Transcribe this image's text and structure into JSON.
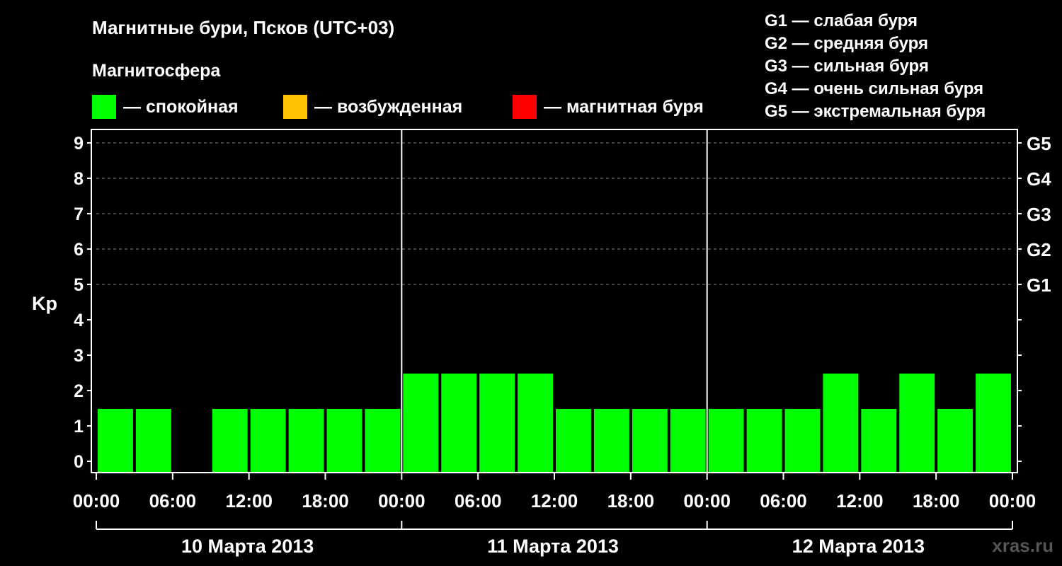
{
  "chart_data": {
    "type": "bar",
    "title": "Магнитные бури, Псков (UTC+03)",
    "subtitle": "Магнитосфера",
    "ylabel": "Kp",
    "ylim": [
      0,
      9
    ],
    "yticks": [
      "0",
      "1",
      "2",
      "3",
      "4",
      "5",
      "6",
      "7",
      "8",
      "9"
    ],
    "g_ticks": [
      {
        "kp": 5,
        "label": "G1"
      },
      {
        "kp": 6,
        "label": "G2"
      },
      {
        "kp": 7,
        "label": "G3"
      },
      {
        "kp": 8,
        "label": "G4"
      },
      {
        "kp": 9,
        "label": "G5"
      }
    ],
    "x_tick_labels": [
      "00:00",
      "06:00",
      "12:00",
      "18:00",
      "00:00",
      "06:00",
      "12:00",
      "18:00",
      "00:00",
      "06:00",
      "12:00",
      "18:00",
      "00:00"
    ],
    "days": [
      "10 Марта 2013",
      "11 Марта 2013",
      "12 Марта 2013"
    ],
    "interval_hours": 3,
    "values": [
      1,
      1,
      0,
      1,
      1,
      1,
      1,
      1,
      2,
      2,
      2,
      2,
      1,
      1,
      1,
      1,
      1,
      1,
      1,
      2,
      1,
      2,
      1,
      2
    ],
    "grid": "dashed-horizontal",
    "legend": [
      {
        "label": "— спокойная",
        "color": "#00ff00"
      },
      {
        "label": "— возбужденная",
        "color": "#ffc000"
      },
      {
        "label": "— магнитная буря",
        "color": "#ff0000"
      }
    ],
    "storm_legend": [
      "G1 — слабая буря",
      "G2 — средняя буря",
      "G3 — сильная буря",
      "G4 — очень сильная буря",
      "G5 — экстремальная буря"
    ]
  },
  "watermark": "xras.ru"
}
